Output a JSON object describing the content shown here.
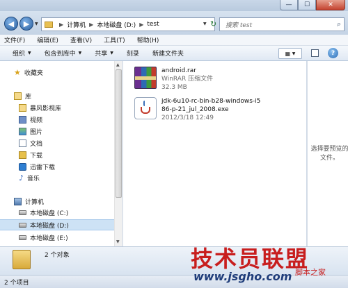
{
  "window": {
    "min": "—",
    "max": "☐",
    "close": "✕"
  },
  "nav": {
    "back": "◀",
    "forward": "▶",
    "breadcrumb": [
      "计算机",
      "本地磁盘 (D:)",
      "test"
    ],
    "search_placeholder": "搜索 test"
  },
  "menu": [
    "文件(F)",
    "编辑(E)",
    "查看(V)",
    "工具(T)",
    "帮助(H)"
  ],
  "toolbar": {
    "organize": "组织",
    "include": "包含到库中",
    "share": "共享",
    "burn": "刻录",
    "new_folder": "新建文件夹",
    "help": "?"
  },
  "sidebar": {
    "favorites": "收藏夹",
    "library": "库",
    "library_items": [
      "暴风影视库",
      "视频",
      "图片",
      "文档",
      "下载",
      "迅雷下载",
      "音乐"
    ],
    "computer": "计算机",
    "drives": [
      "本地磁盘 (C:)",
      "本地磁盘 (D:)",
      "本地磁盘 (E:)"
    ]
  },
  "files": [
    {
      "name": "android.rar",
      "type": "WinRAR 压缩文件",
      "size": "32.3 MB"
    },
    {
      "name_line1": "jdk-6u10-rc-bin-b28-windows-i5",
      "name_line2": "86-p-21_jul_2008.exe",
      "date": "2012/3/18 12:49"
    }
  ],
  "preview": {
    "text": "选择要预览的文件。"
  },
  "details": {
    "count": "2 个对象"
  },
  "status": {
    "text": "2 个项目"
  },
  "watermark": {
    "main": "技术员联盟",
    "sub": "www.jsgho.com",
    "tag": "脚本之家"
  }
}
